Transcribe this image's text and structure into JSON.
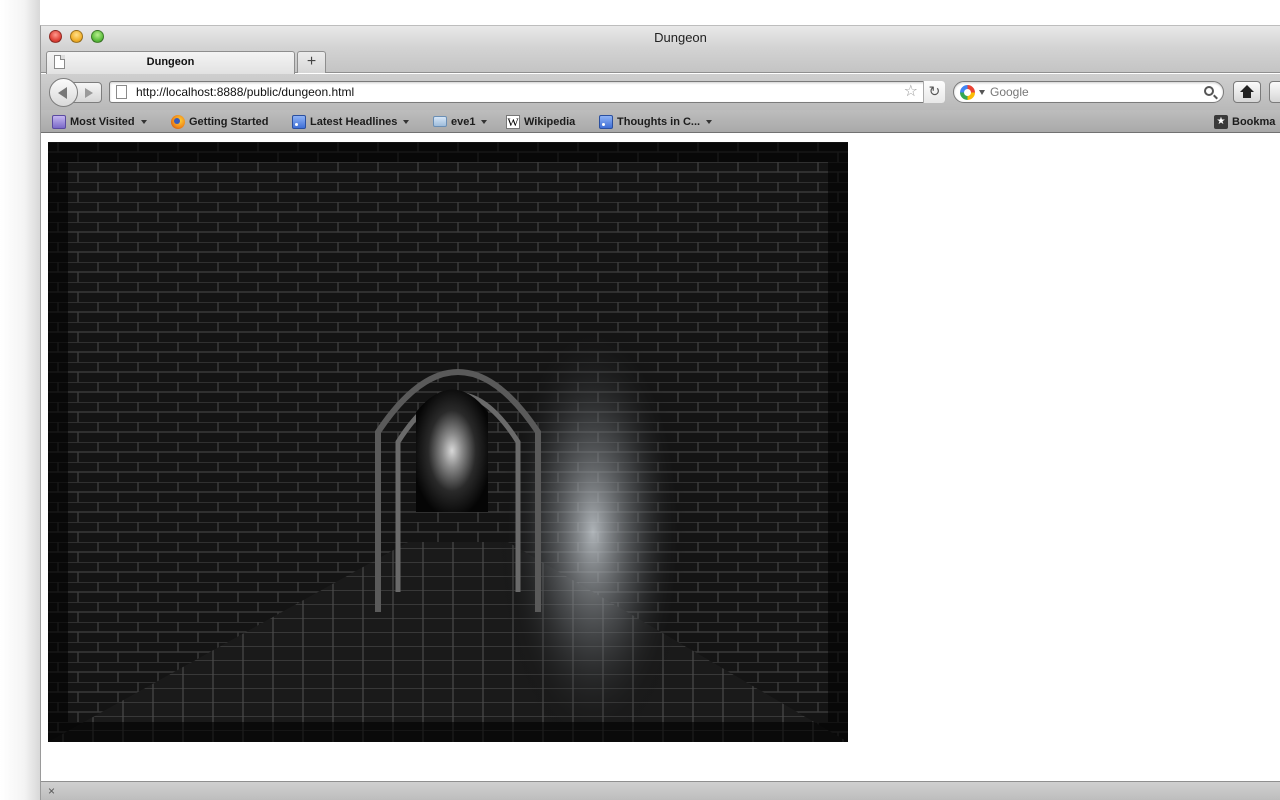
{
  "window": {
    "title": "Dungeon"
  },
  "tabs": [
    {
      "label": "Dungeon"
    }
  ],
  "newtab": {
    "label": "+"
  },
  "navbar": {
    "url": "http://localhost:8888/public/dungeon.html",
    "search_placeholder": "Google"
  },
  "bookmarks": {
    "items": [
      {
        "label": "Most Visited",
        "icon": "most-visited-icon",
        "dropdown": true
      },
      {
        "label": "Getting Started",
        "icon": "firefox-icon",
        "dropdown": false
      },
      {
        "label": "Latest Headlines",
        "icon": "rss-icon",
        "dropdown": true
      },
      {
        "label": "eve1",
        "icon": "folder-icon",
        "dropdown": true
      },
      {
        "label": "Wikipedia",
        "icon": "wikipedia-icon",
        "dropdown": false
      },
      {
        "label": "Thoughts in C...",
        "icon": "rss-icon",
        "dropdown": true
      }
    ],
    "overflow_label": "Bookma"
  },
  "content": {
    "scene": "dungeon-corridor"
  },
  "statusbar": {
    "close_glyph": "×"
  }
}
